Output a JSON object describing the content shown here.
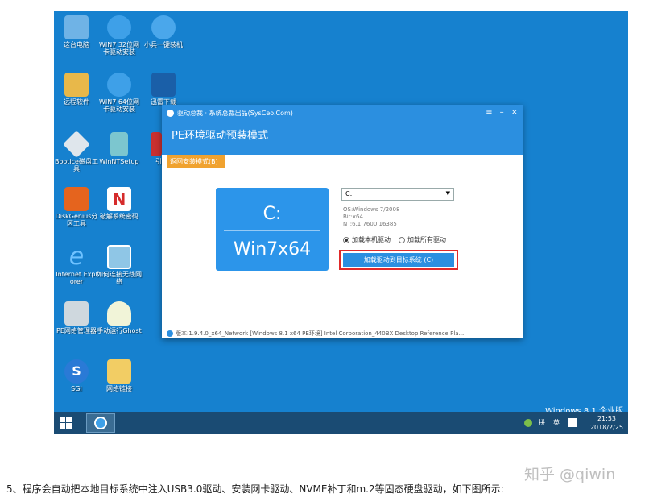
{
  "desktop": {
    "icons": [
      {
        "label": "这台电脑",
        "icon": "computer-icon",
        "color": "#6fb3e6"
      },
      {
        "label": "WIN7 32位网卡驱动安装",
        "icon": "gear-icon",
        "color": "#3ea0e8"
      },
      {
        "label": "小兵一键装机",
        "icon": "installer-icon",
        "color": "#4aa7eb"
      },
      {
        "label": "远程软件",
        "icon": "remote-icon",
        "color": "#e8b84a"
      },
      {
        "label": "WIN7 64位网卡驱动安装",
        "icon": "gear-icon",
        "color": "#3ea0e8"
      },
      {
        "label": "迅雷下载",
        "icon": "thunder-icon",
        "color": "#1a5fa8"
      },
      {
        "label": "Bootice磁盘工具",
        "icon": "disk-icon",
        "color": "#dfe6ec"
      },
      {
        "label": "WinNTSetup",
        "icon": "setup-icon",
        "color": "#7cc6cf"
      },
      {
        "label": "引",
        "icon": "app-icon",
        "color": "#c83030"
      },
      {
        "label": "DiskGenius分区工具",
        "icon": "diskgenius-icon",
        "color": "#e5641e"
      },
      {
        "label": "破解系统密码",
        "icon": "password-icon",
        "color": "#d52b2b"
      },
      {
        "label": "Internet Explorer",
        "icon": "ie-icon",
        "color": "#1f8fe8"
      },
      {
        "label": "如何连接无线网络",
        "icon": "wifi-image-icon",
        "color": "#8fc6e6"
      },
      {
        "label": "PE网络管理器",
        "icon": "network-icon",
        "color": "#cfd8de"
      },
      {
        "label": "手动运行Ghost",
        "icon": "ghost-icon",
        "color": "#f1f4d8"
      },
      {
        "label": "SGI",
        "icon": "sgi-icon",
        "color": "#2a7ad6"
      },
      {
        "label": "网络链接",
        "icon": "folder-icon",
        "color": "#f2cd64"
      }
    ],
    "watermark": "Windows 8.1 企业版"
  },
  "window": {
    "title": "驱动总裁 · 系统总裁出品(SysCeo.Com)",
    "title_buttons": [
      "≡",
      "–",
      "×"
    ],
    "heading": "PE环境驱动预装模式",
    "return_tab": "返回安装模式(B)",
    "drive_tile": {
      "letter": "C:",
      "os": "Win7x64"
    },
    "drive_select": "C:",
    "os_info": [
      "OS:Windows 7/2008",
      "Bit:x64",
      "NT:6.1.7600.16385"
    ],
    "radio_local": "加载本机驱动",
    "radio_all": "加载所有驱动",
    "inject_button": "加载驱动到目标系统 (C)",
    "status": "版本:1.9.4.0_x64_Network [Windows 8.1 x64 PE环境] Intel Corporation_440BX Desktop Reference Pla..."
  },
  "taskbar": {
    "tray": [
      "拼",
      "英"
    ],
    "time": "21:53",
    "date": "2018/2/25"
  },
  "page": {
    "brand_watermark": "知乎 @qiwin",
    "caption": "5、程序会自动把本地目标系统中注入USB3.0驱动、安装网卡驱动、NVME补丁和m.2等固态硬盘驱动，如下图所示:"
  },
  "colors": {
    "desktop": "#1681cf",
    "accent": "#2b8fe0",
    "highlight": "#e02a2a",
    "tab": "#f0a22f"
  }
}
